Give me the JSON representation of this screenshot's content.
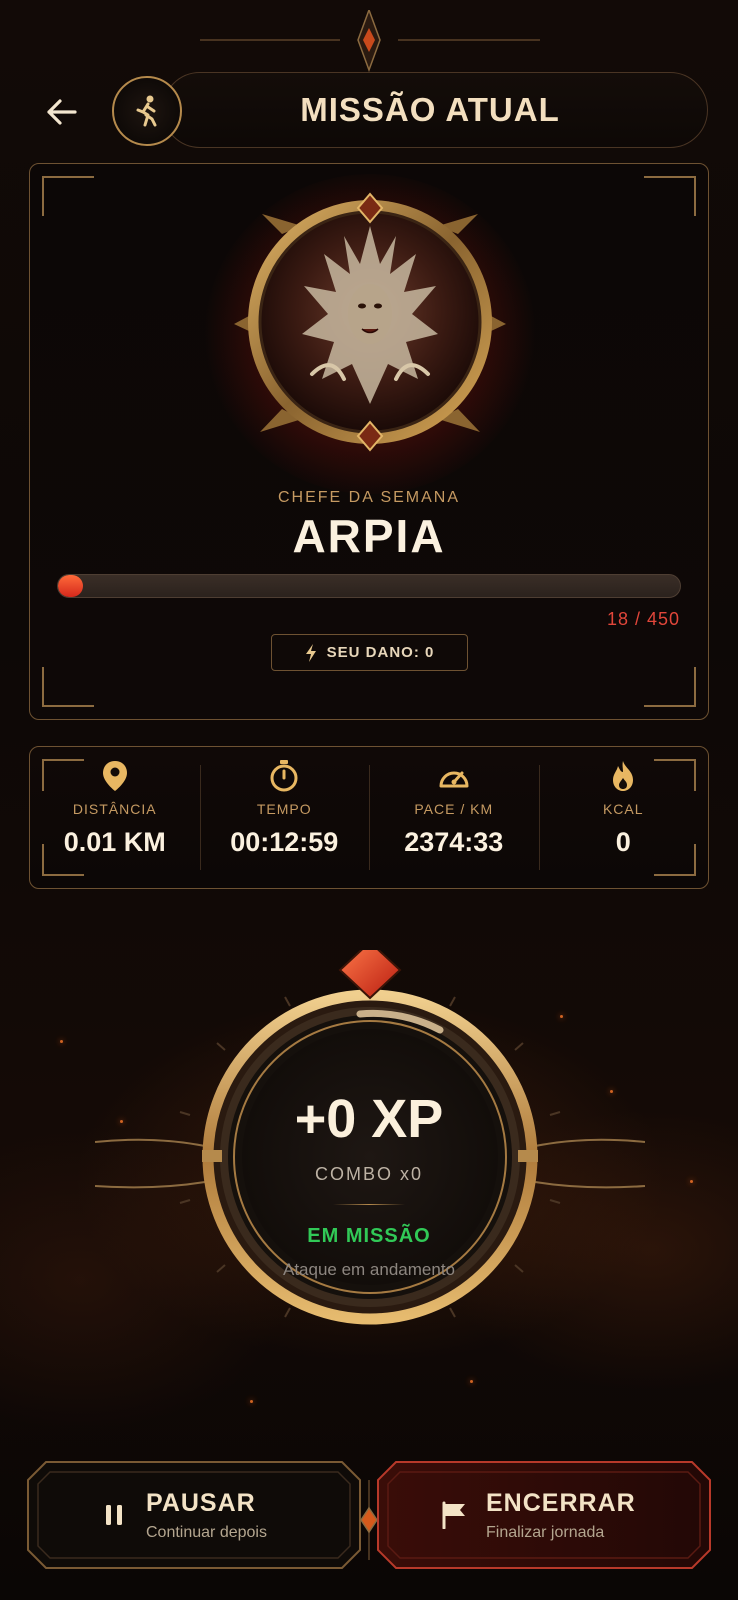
{
  "header": {
    "title": "MISSÃO ATUAL",
    "back_icon": "back-arrow-icon",
    "mission_icon": "runner-icon"
  },
  "boss": {
    "subtitle": "CHEFE DA SEMANA",
    "name": "ARPIA",
    "hp_current": 18,
    "hp_max": 450,
    "hp_text": "18 / 450",
    "damage_label": "SEU DANO: 0"
  },
  "stats": [
    {
      "icon": "location-pin-icon",
      "label": "DISTÂNCIA",
      "value": "0.01 KM"
    },
    {
      "icon": "stopwatch-icon",
      "label": "TEMPO",
      "value": "00:12:59"
    },
    {
      "icon": "speedometer-icon",
      "label": "PACE / KM",
      "value": "2374:33"
    },
    {
      "icon": "flame-icon",
      "label": "KCAL",
      "value": "0"
    }
  ],
  "xp": {
    "value": "+0 XP",
    "combo": "COMBO x0",
    "status": "EM MISSÃO",
    "status_sub": "Ataque em andamento"
  },
  "actions": {
    "pause": {
      "title": "PAUSAR",
      "subtitle": "Continuar depois",
      "icon": "pause-icon"
    },
    "end": {
      "title": "ENCERRAR",
      "subtitle": "Finalizar jornada",
      "icon": "flag-icon"
    }
  },
  "colors": {
    "gold": "#b58a4c",
    "accent_red": "#d4281c",
    "status_green": "#31c957"
  }
}
